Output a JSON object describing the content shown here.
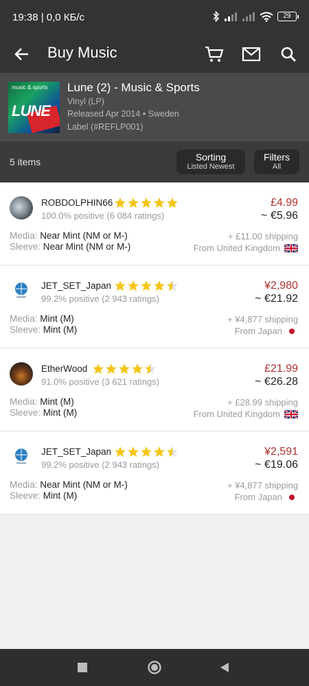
{
  "status_bar": {
    "time_text": "19:38 | 0,0 КБ/с",
    "battery": "29"
  },
  "app_bar": {
    "title": "Buy Music",
    "icons": [
      "back-arrow-icon",
      "cart-icon",
      "mail-icon",
      "search-icon"
    ]
  },
  "release": {
    "title": "Lune (2) - Music & Sports",
    "format": "Vinyl (LP)",
    "released": "Released Apr 2014 • Sweden",
    "label": "Label  (#REFLP001)",
    "cover_top_text": "music & sports",
    "cover_title_text": "LUNE"
  },
  "filter_bar": {
    "item_count": "5 items",
    "sorting_label": "Sorting",
    "sorting_value": "Listed Newest",
    "filters_label": "Filters",
    "filters_value": "All"
  },
  "listings": [
    {
      "seller": "ROBDOLPHIN66",
      "rating_stars": 5,
      "positive": "100.0% positive (6 084 ratings)",
      "price": "£4.99",
      "converted": "~ €5.96",
      "media_label": "Media:",
      "media": "Near Mint (NM or M-)",
      "sleeve_label": "Sleeve:",
      "sleeve": "Near Mint (NM or M-)",
      "shipping": "+ £11.00 shipping",
      "origin": "From United Kingdom",
      "flag": "uk-flag-icon"
    },
    {
      "seller": "JET_SET_Japan",
      "rating_stars": 4.5,
      "positive": "99.2% positive (2 943 ratings)",
      "price": "¥2,980",
      "converted": "~ €21.92",
      "media_label": "Media:",
      "media": "Mint (M)",
      "sleeve_label": "Sleeve:",
      "sleeve": "Mint (M)",
      "shipping": "+ ¥4,877 shipping",
      "origin": "From Japan",
      "flag": "japan-flag-icon"
    },
    {
      "seller": "EtherWood",
      "rating_stars": 4.5,
      "positive": "91.0% positive (3 621 ratings)",
      "price": "£21.99",
      "converted": "~ €26.28",
      "media_label": "Media:",
      "media": "Mint (M)",
      "sleeve_label": "Sleeve:",
      "sleeve": "Mint (M)",
      "shipping": "+ £28.99 shipping",
      "origin": "From United Kingdom",
      "flag": "uk-flag-icon"
    },
    {
      "seller": "JET_SET_Japan",
      "rating_stars": 4.5,
      "positive": "99.2% positive (2 943 ratings)",
      "price": "¥2,591",
      "converted": "~ €19.06",
      "media_label": "Media:",
      "media": "Near Mint (NM or M-)",
      "sleeve_label": "Sleeve:",
      "sleeve": "Mint (M)",
      "shipping": "+ ¥4,877 shipping",
      "origin": "From Japan",
      "flag": "japan-flag-icon"
    }
  ],
  "colors": {
    "bar_dark": "#333333",
    "release_bg": "#4a4a4a",
    "filter_bg": "#3b3b3b",
    "price_red": "#b03030",
    "star_gold": "#f5c518"
  },
  "nav_bar": {
    "icons": [
      "square-recents-icon",
      "circle-home-icon",
      "triangle-back-icon"
    ]
  }
}
